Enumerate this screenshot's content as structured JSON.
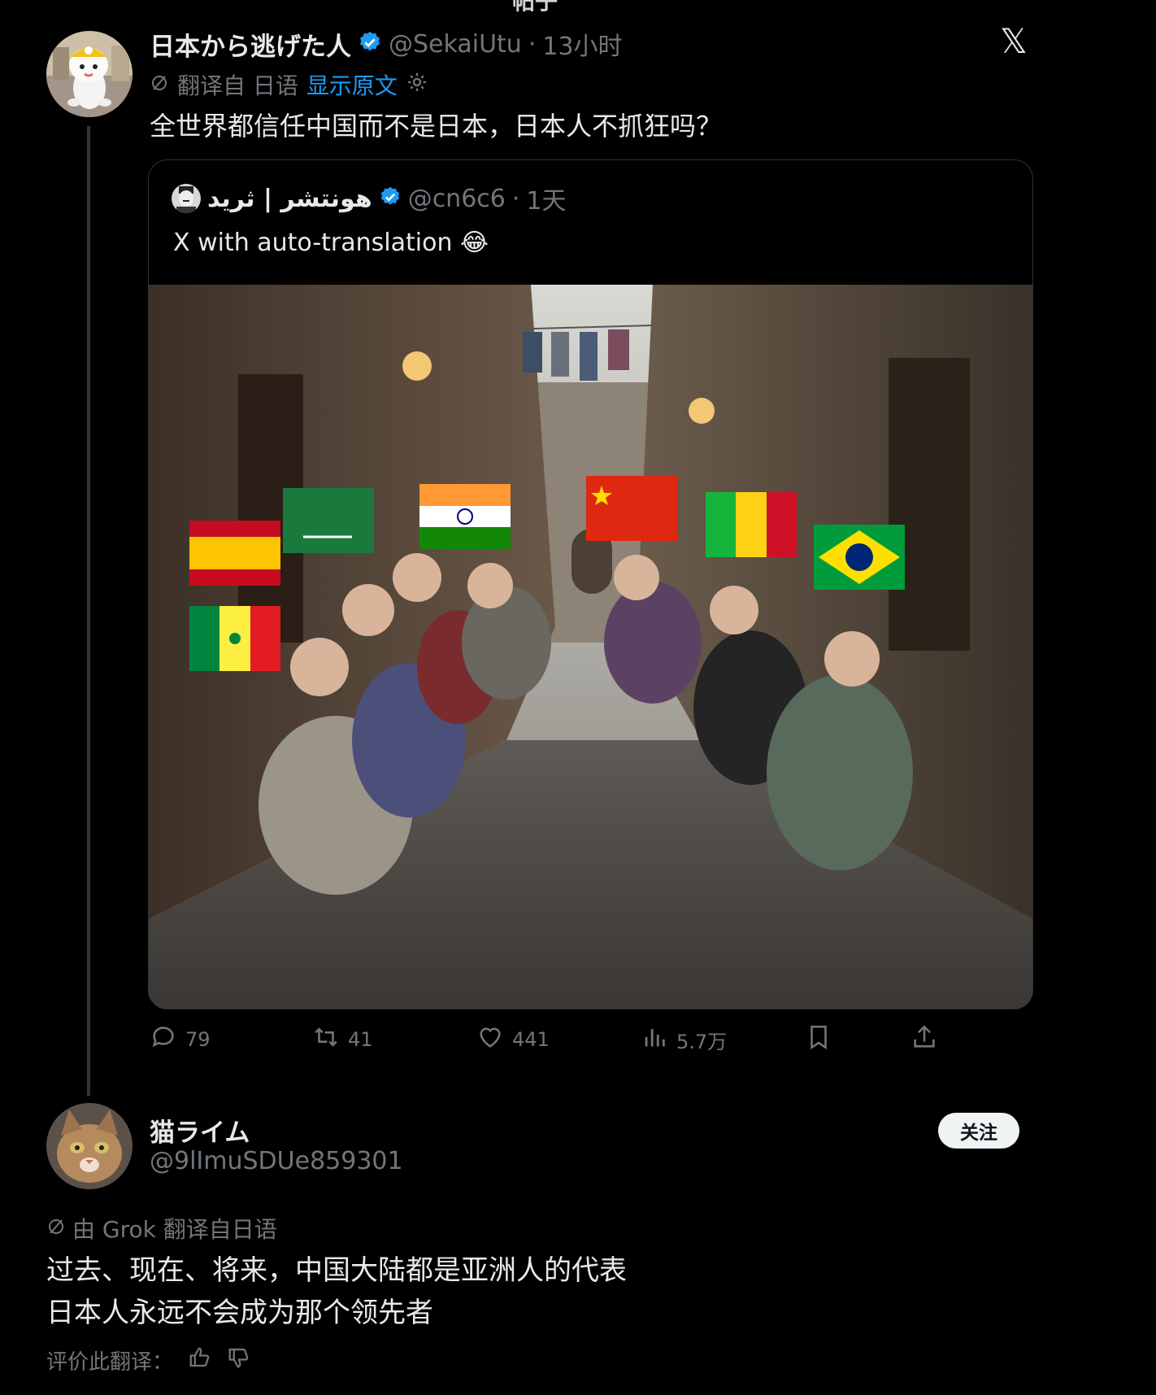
{
  "page": {
    "top_fragment": "帖子"
  },
  "tweet": {
    "display_name": "日本から逃げた人",
    "handle": "@SekaiUtu",
    "time_sep": "·",
    "time": "13小时",
    "translated_from": "翻译自 日语",
    "show_original": "显示原文",
    "text": "全世界都信任中国而不是日本，日本人不抓狂吗？",
    "x_logo": "𝕏"
  },
  "quote": {
    "display_name": "هونتشر | ثريد",
    "handle": "@cn6c6",
    "time_sep": "·",
    "time": "1天",
    "text": "X with auto-translation 😂",
    "flags": [
      "Spain",
      "Saudi Arabia",
      "India",
      "China",
      "Mali",
      "Brazil",
      "Senegal"
    ]
  },
  "actions": {
    "replies": "79",
    "reposts": "41",
    "likes": "441",
    "views": "5.7万"
  },
  "reply": {
    "display_name": "猫ライム",
    "handle": "@9lImuSDUe859301",
    "follow_label": "关注",
    "translated_by": "由 Grok 翻译自日语",
    "line1": "过去、现在、将来，中国大陆都是亚洲人的代表",
    "line2": "日本人永远不会成为那个领先者",
    "rate_label": "评价此翻译："
  },
  "colors": {
    "background": "#000000",
    "text": "#e7e9ea",
    "muted": "#71767b",
    "link_blue": "#1d9bf0",
    "verified_blue": "#1d9bf0"
  }
}
